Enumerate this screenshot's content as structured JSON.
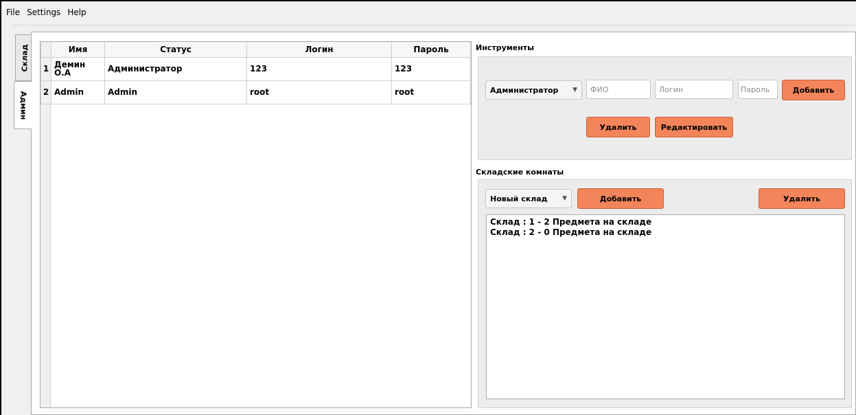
{
  "menu": [
    "File",
    "Settings",
    "Help"
  ],
  "tabs": [
    "Склад",
    "Админ"
  ],
  "table": {
    "columns": [
      "Имя",
      "Статус",
      "Логин",
      "Пароль"
    ],
    "rows": [
      {
        "num": "1",
        "cells": [
          "Демин О.А",
          "Администратор",
          "123",
          "123"
        ]
      },
      {
        "num": "2",
        "cells": [
          "Admin",
          "Admin",
          "root",
          "root"
        ]
      }
    ]
  },
  "tools": {
    "title": "Инструменты",
    "role_select": "Администратор",
    "fio_placeholder": "ФИО",
    "login_placeholder": "Логин",
    "password_placeholder": "Пароль",
    "add_label": "Добавить",
    "delete_label": "Удалить",
    "edit_label": "Редактировать"
  },
  "rooms": {
    "title": "Складские комнаты",
    "room_select": "Новый склад",
    "add_label": "Добавить",
    "delete_label": "Удалить",
    "items": [
      "Склад : 1 - 2 Предмета на складе",
      "Склад : 2 - 0 Предмета на складе"
    ]
  },
  "colors": {
    "button_accent": "#f4855a"
  }
}
